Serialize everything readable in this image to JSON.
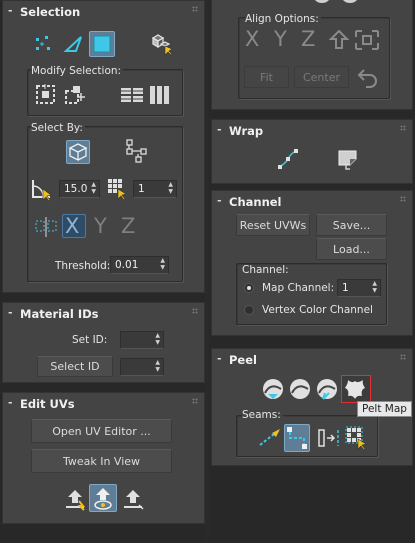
{
  "left": {
    "selection": {
      "title": "Selection",
      "toggle": "-",
      "modify_label": "Modify Selection:",
      "select_by_label": "Select By:",
      "angle_value": "15.0",
      "grow_value": "1",
      "threshold_label": "Threshold:",
      "threshold_value": "0.01",
      "axis_x": "X",
      "axis_y": "Y",
      "axis_z": "Z"
    },
    "material_ids": {
      "title": "Material IDs",
      "toggle": "-",
      "set_id_label": "Set ID:",
      "select_id_label": "Select ID"
    },
    "edit_uvs": {
      "title": "Edit UVs",
      "toggle": "-",
      "open_editor_label": "Open UV Editor ...",
      "tweak_label": "Tweak In View"
    }
  },
  "right": {
    "align": {
      "label": "Align Options:",
      "axis_x": "X",
      "axis_y": "Y",
      "axis_z": "Z",
      "fit_label": "Fit",
      "center_label": "Center"
    },
    "wrap": {
      "title": "Wrap",
      "toggle": "-"
    },
    "channel": {
      "title": "Channel",
      "toggle": "-",
      "reset_label": "Reset UVWs",
      "save_label": "Save...",
      "load_label": "Load...",
      "group_label": "Channel:",
      "map_channel_label": "Map Channel:",
      "map_channel_value": "1",
      "vertex_color_label": "Vertex Color Channel"
    },
    "peel": {
      "title": "Peel",
      "toggle": "-",
      "seams_label": "Seams:",
      "tooltip": "Pelt Map"
    }
  },
  "colors": {
    "panel": "#444444",
    "background": "#282828",
    "active": "#5f7d94",
    "accent_cyan": "#3ec7e6",
    "tooltip_highlight": "#e03030"
  }
}
